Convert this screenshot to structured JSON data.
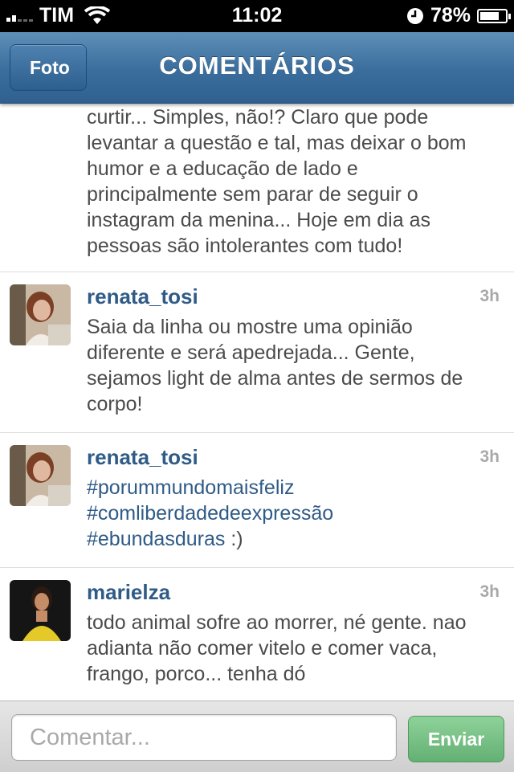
{
  "status_bar": {
    "carrier": "TIM",
    "time": "11:02",
    "battery_percent": "78%",
    "battery_level": 0.78,
    "icons": [
      "signal-icon",
      "wifi-icon",
      "clock-icon",
      "battery-icon"
    ]
  },
  "nav": {
    "back_label": "Foto",
    "title": "COMENTÁRIOS"
  },
  "intro_text": "curtir... Simples, não!? Claro que pode levantar a questão e tal, mas deixar o bom humor e a educação de lado e principalmente sem parar de seguir o instagram da menina... Hoje em dia as pessoas são intolerantes com tudo!",
  "comments": [
    {
      "username": "renata_tosi",
      "time": "3h",
      "text": "Saia da linha ou mostre uma opinião diferente e será apedrejada... Gente, sejamos light de alma antes de sermos de corpo!"
    },
    {
      "username": "renata_tosi",
      "time": "3h",
      "hashtags": [
        "#porummundomaisfeliz",
        "#comliberdadedeexpressão",
        "#ebundasduras"
      ],
      "suffix": " :)"
    },
    {
      "username": "marielza",
      "time": "3h",
      "text": "todo animal sofre ao morrer, né gente. nao adianta não comer vitelo e comer vaca, frango, porco... tenha dó"
    }
  ],
  "composer": {
    "placeholder": "Comentar...",
    "send_label": "Enviar"
  },
  "colors": {
    "nav_blue": "#3a6d9c",
    "username_blue": "#2f5b87",
    "send_green": "#64b073"
  }
}
